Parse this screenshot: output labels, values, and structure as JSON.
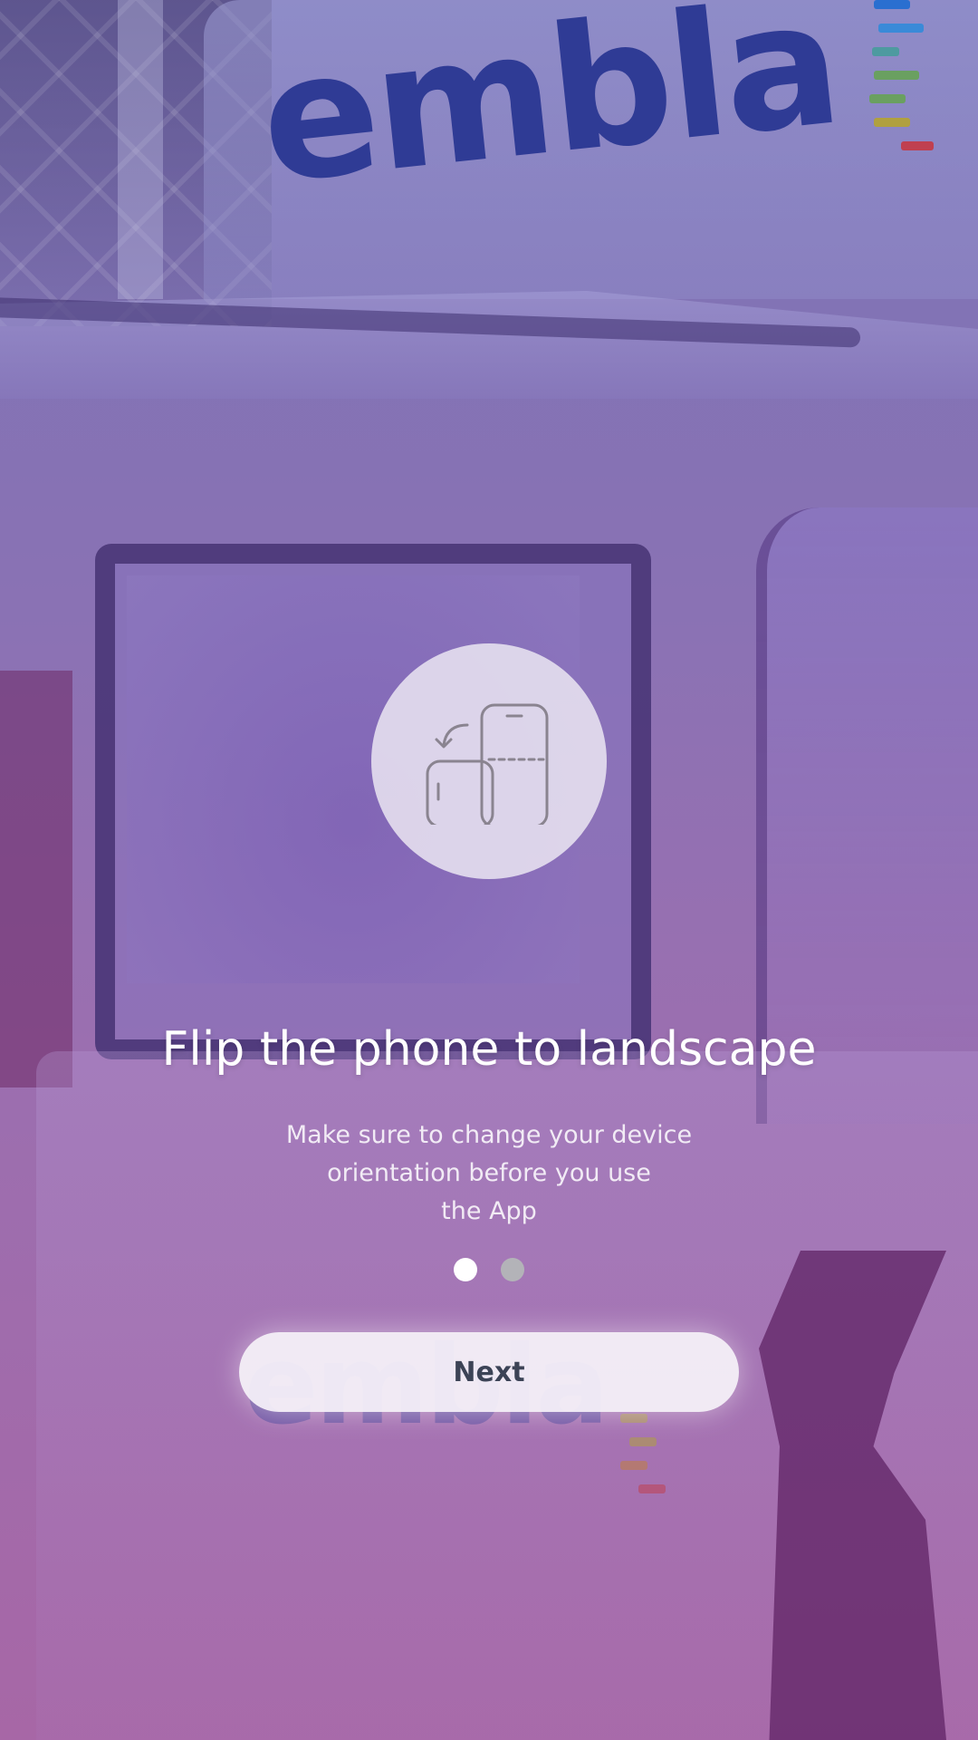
{
  "background": {
    "brand_text": "embla",
    "brand_color": "#2f3b95",
    "stripe_colors": [
      "#2a6fd0",
      "#3a8ad8",
      "#4e9aa0",
      "#6aa060",
      "#b0a040",
      "#c04050"
    ]
  },
  "onboarding": {
    "icon": "rotate-phone-landscape-icon",
    "title": "Flip the phone to landscape",
    "subtitle_lines": [
      "Make sure to change your device",
      "orientation before you use",
      "the App"
    ],
    "page_indicator": {
      "current": 1,
      "total": 2
    },
    "next_label": "Next"
  },
  "colors": {
    "overlay_top": "#7a74b6",
    "overlay_bottom": "#a767a6",
    "button_bg": "#f4f0f8",
    "button_text": "#3c4356",
    "dot_active": "#ffffff",
    "dot_inactive": "#b3b3b8"
  }
}
